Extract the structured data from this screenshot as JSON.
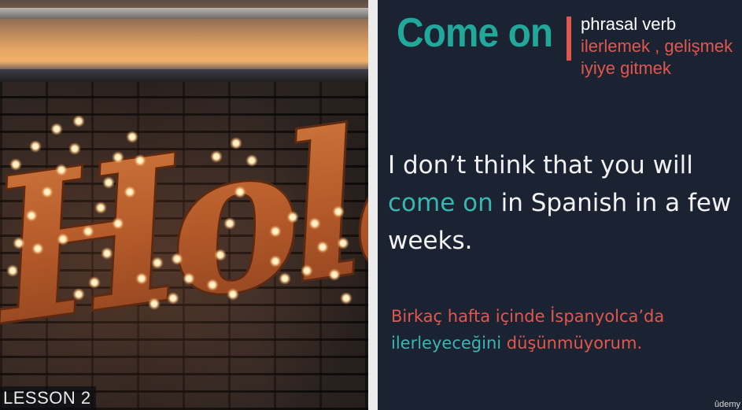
{
  "left_panel": {
    "sign_text": "Hola",
    "lesson_label": "LESSON 2"
  },
  "slide": {
    "phrase": "Come on",
    "type": "phrasal verb",
    "meaning_line1": "ilerlemek , gelişmek",
    "meaning_line2": "iyiye gitmek",
    "example": {
      "part1": "I don’t think that you will",
      "highlight": "come on",
      "part2": "in Spanish in a few weeks."
    },
    "translation": {
      "part1": "Birkaç hafta içinde İspanyolca’da",
      "highlight": "ilerleyeceğini",
      "part2": "düşünmüyorum."
    }
  },
  "watermark": "ûdemy",
  "colors": {
    "background": "#1b2333",
    "teal": "#21a89a",
    "coral": "#e0574e",
    "bulb": "#ffe7b0"
  }
}
